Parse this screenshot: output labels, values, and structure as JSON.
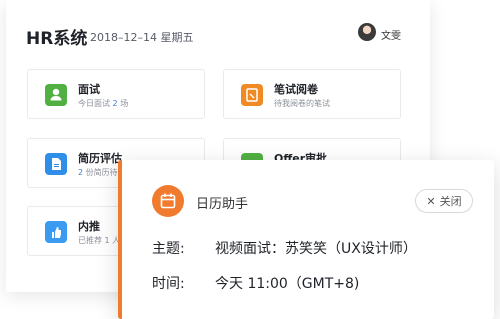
{
  "header": {
    "title": "HR系统",
    "date": "2018–12–14 星期五",
    "user_name": "文雯"
  },
  "cards": [
    {
      "title": "面试",
      "sub_prefix": "今日面试",
      "sub_value": "2",
      "sub_suffix": "场",
      "color": "#52b043",
      "icon": "person-icon"
    },
    {
      "title": "笔试阅卷",
      "sub_text": "待我阅卷的笔试",
      "color": "#f08a24",
      "icon": "pencil-icon"
    },
    {
      "title": "简历评估",
      "sub_value": "2",
      "sub_suffix": "份简历待",
      "color": "#2f8fe8",
      "icon": "document-icon"
    },
    {
      "title": "Offer审批",
      "color": "#52b043",
      "icon": "check-icon"
    },
    {
      "title": "内推",
      "sub_text": "已推荐 1 人",
      "color": "#3a9bf0",
      "icon": "thumbs-up-icon"
    }
  ],
  "popup": {
    "title": "日历助手",
    "close_label": "关闭",
    "subject_label": "主题:",
    "subject_value": "视频面试：苏笑笑（UX设计师）",
    "time_label": "时间:",
    "time_value": "今天 11:00（GMT+8)",
    "accent": "#f07b2f"
  }
}
